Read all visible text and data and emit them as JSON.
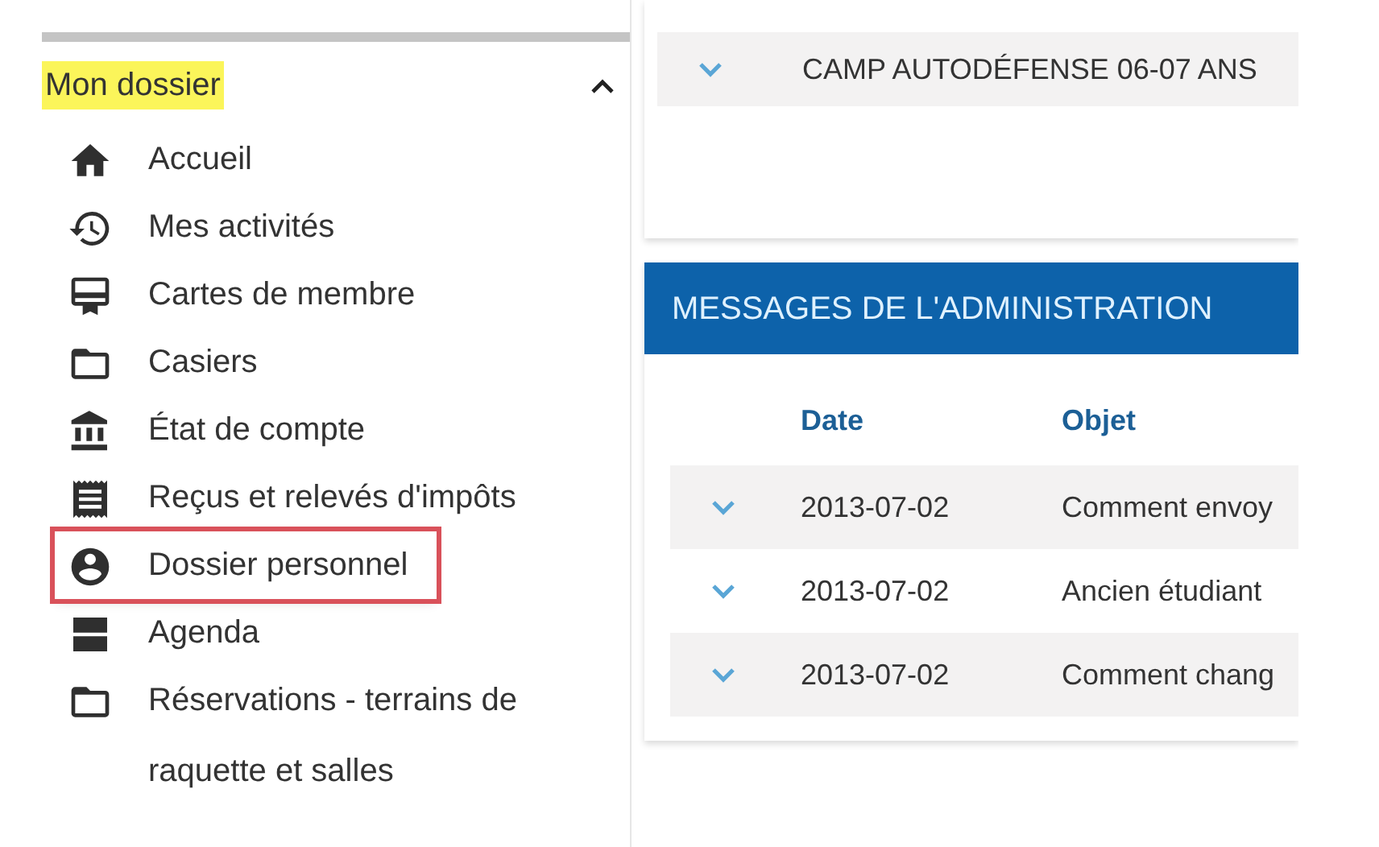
{
  "sidebar": {
    "section": {
      "title": "Mon dossier",
      "highlighted": true,
      "expanded": true
    },
    "items": [
      {
        "label": "Accueil",
        "kind": "home",
        "highlighted": false
      },
      {
        "label": "Mes activités",
        "kind": "history",
        "highlighted": false
      },
      {
        "label": "Cartes de membre",
        "kind": "card",
        "highlighted": false
      },
      {
        "label": "Casiers",
        "kind": "folder",
        "highlighted": false
      },
      {
        "label": "État de compte",
        "kind": "bank",
        "highlighted": false
      },
      {
        "label": "Reçus et relevés d'impôts",
        "kind": "receipt",
        "highlighted": false
      },
      {
        "label": "Dossier personnel",
        "kind": "account",
        "highlighted": true
      },
      {
        "label": "Agenda",
        "kind": "agenda",
        "highlighted": false
      },
      {
        "label": "Réservations - terrains de raquette et salles",
        "kind": "folder",
        "highlighted": false
      }
    ]
  },
  "activities": {
    "rows": [
      {
        "title": "CAMP AUTODÉFENSE 06-07 ANS"
      }
    ]
  },
  "messages": {
    "title": "MESSAGES DE L'ADMINISTRATION",
    "columns": [
      "Date",
      "Objet"
    ],
    "rows": [
      {
        "date": "2013-07-02",
        "subject": "Comment envoy"
      },
      {
        "date": "2013-07-02",
        "subject": "Ancien étudiant"
      },
      {
        "date": "2013-07-02",
        "subject": "Comment chang"
      }
    ]
  }
}
